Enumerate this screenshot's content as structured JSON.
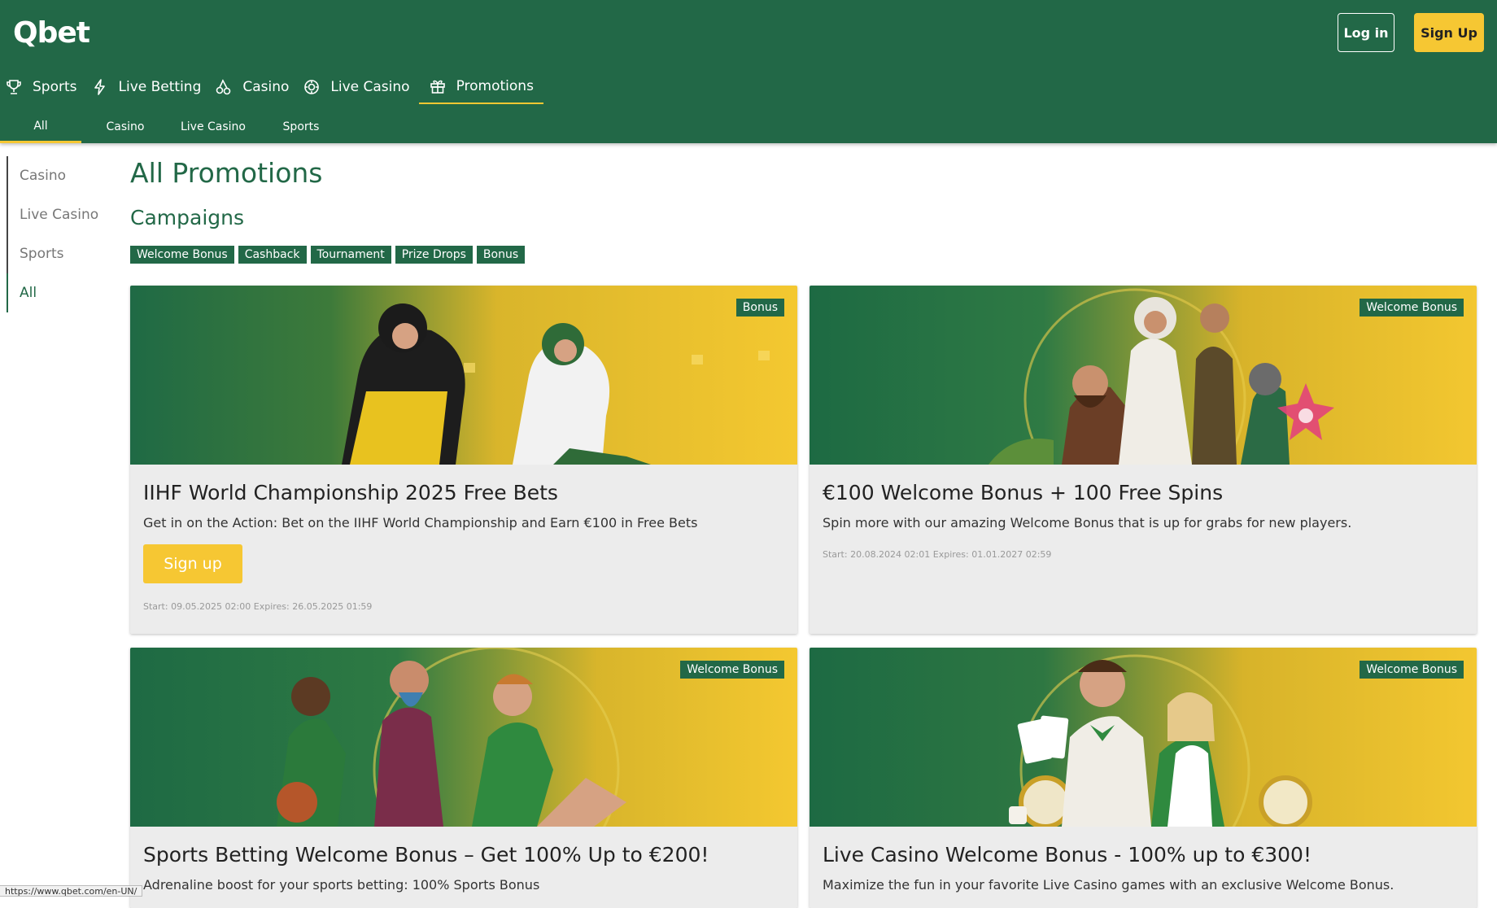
{
  "brand": {
    "logo_text": "Qbet",
    "primary": "#226847",
    "accent": "#f6c733"
  },
  "header": {
    "login_label": "Log in",
    "signup_label": "Sign Up"
  },
  "main_nav": [
    {
      "label": "Sports",
      "icon": "trophy-icon"
    },
    {
      "label": "Live Betting",
      "icon": "lightning-icon"
    },
    {
      "label": "Casino",
      "icon": "cherries-icon"
    },
    {
      "label": "Live Casino",
      "icon": "chip-icon"
    },
    {
      "label": "Promotions",
      "icon": "gift-icon",
      "active": true
    }
  ],
  "sub_nav": [
    {
      "label": "All",
      "active": true
    },
    {
      "label": "Casino"
    },
    {
      "label": "Live Casino"
    },
    {
      "label": "Sports"
    }
  ],
  "sidebar": [
    {
      "label": "Casino"
    },
    {
      "label": "Live Casino"
    },
    {
      "label": "Sports"
    },
    {
      "label": "All",
      "active": true
    }
  ],
  "page": {
    "title": "All Promotions",
    "section_title": "Campaigns"
  },
  "campaign_tags": [
    "Welcome Bonus",
    "Cashback",
    "Tournament",
    "Prize Drops",
    "Bonus"
  ],
  "cards": [
    {
      "badge": "Bonus",
      "title": "IIHF World Championship 2025 Free Bets",
      "description": "Get in on the Action: Bet on the IIHF World Championship and Earn €100 in Free Bets",
      "cta": "Sign up",
      "dates": "Start: 09.05.2025 02:00   Expires: 26.05.2025 01:59"
    },
    {
      "badge": "Welcome Bonus",
      "title": "€100 Welcome Bonus + 100 Free Spins",
      "description": "Spin more with our amazing Welcome Bonus that is up for grabs for new players.",
      "dates": "Start: 20.08.2024 02:01   Expires: 01.01.2027 02:59"
    },
    {
      "badge": "Welcome Bonus",
      "title": "Sports Betting Welcome Bonus – Get 100% Up to €200!",
      "description": "Adrenaline boost for your sports betting: 100% Sports Bonus"
    },
    {
      "badge": "Welcome Bonus",
      "title": "Live Casino Welcome Bonus - 100% up to €300!",
      "description": "Maximize the fun in your favorite Live Casino games with an exclusive Welcome Bonus."
    }
  ],
  "status_bar": {
    "url": "https://www.qbet.com/en-UN/"
  }
}
